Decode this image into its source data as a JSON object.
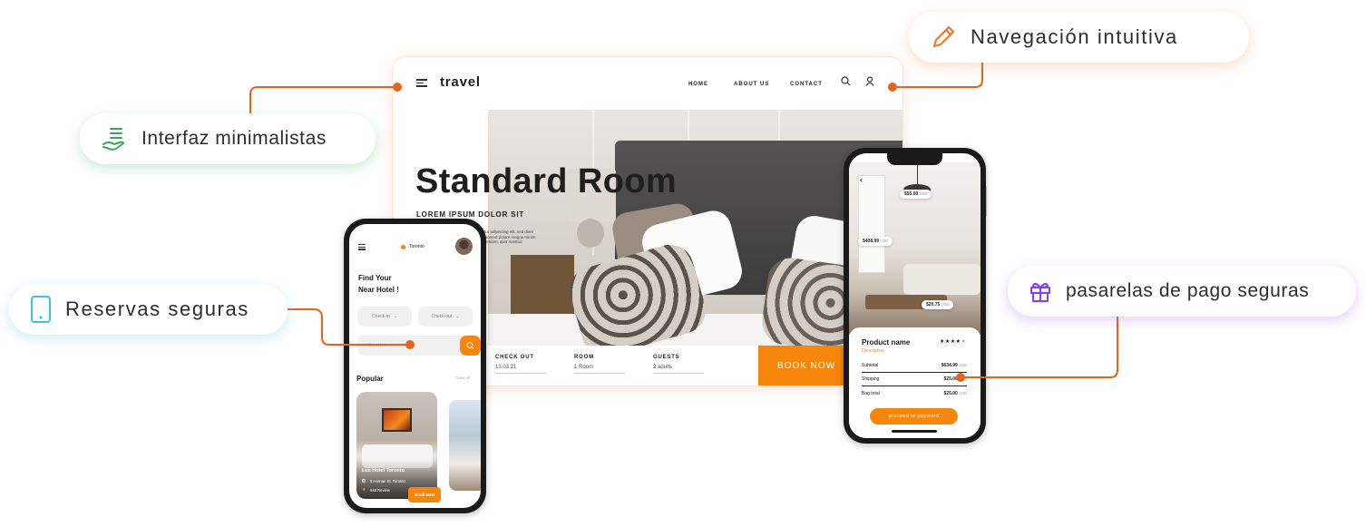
{
  "features": {
    "navigation": "Navegación intuitiva",
    "interface": "Interfaz minimalistas",
    "bookings": "Reservas seguras",
    "payments": "pasarelas de pago seguras"
  },
  "desktop": {
    "logo": "travel",
    "nav": [
      "HOME",
      "ABOUT US",
      "CONTACT"
    ],
    "hero_title": "Standard Room",
    "hero_subtitle": "LOREM IPSUM DOLOR SIT",
    "hero_desc": "tur adipiscing elit, sed diam iscered dolore magna minim veniam, quis nostrud",
    "booking": {
      "fields": [
        {
          "label": "CHECK OUT",
          "value": "13.03.21"
        },
        {
          "label": "ROOM",
          "value": "1 Room"
        },
        {
          "label": "GUESTS",
          "value": "2 adults"
        }
      ],
      "button": "BOOK NOW"
    },
    "icons": {
      "menu": "menu-icon",
      "search": "search-icon",
      "user": "user-icon"
    }
  },
  "mobile_search": {
    "location": "Toronto",
    "title_line1": "Find Your",
    "title_line2": "Near Hotel !",
    "check_in": "Check-in",
    "check_out": "Check-out",
    "search_placeholder": "Search...",
    "popular": "Popular",
    "view_all": "View all",
    "card": {
      "name": "Lux Hotel Toronto",
      "address": "6 Avenue St. Toronto",
      "reviews": "648 Review",
      "button": "Book Now"
    }
  },
  "mobile_product": {
    "tags": [
      {
        "price": "$55.00",
        "currency": "USD"
      },
      {
        "price": "$408.99",
        "currency": "USD"
      },
      {
        "price": "$20.75",
        "currency": "USD"
      }
    ],
    "product_name": "Product name",
    "rating_stars": "★★★★",
    "rating_empty": "★",
    "description": "Description",
    "rows": [
      {
        "label": "Subtotal",
        "value": "$634.99",
        "currency": "USD"
      },
      {
        "label": "Shipping",
        "value": "$25.00",
        "currency": "USD"
      },
      {
        "label": "Bag total",
        "value": "$25.00",
        "currency": "USD"
      }
    ],
    "button": "proceed to payment"
  },
  "colors": {
    "accent": "#f7860d",
    "connector": "#e4641a",
    "green_icon": "#3aa65a",
    "cyan_icon": "#3cc2e6",
    "purple_icon": "#8a3cf0"
  }
}
